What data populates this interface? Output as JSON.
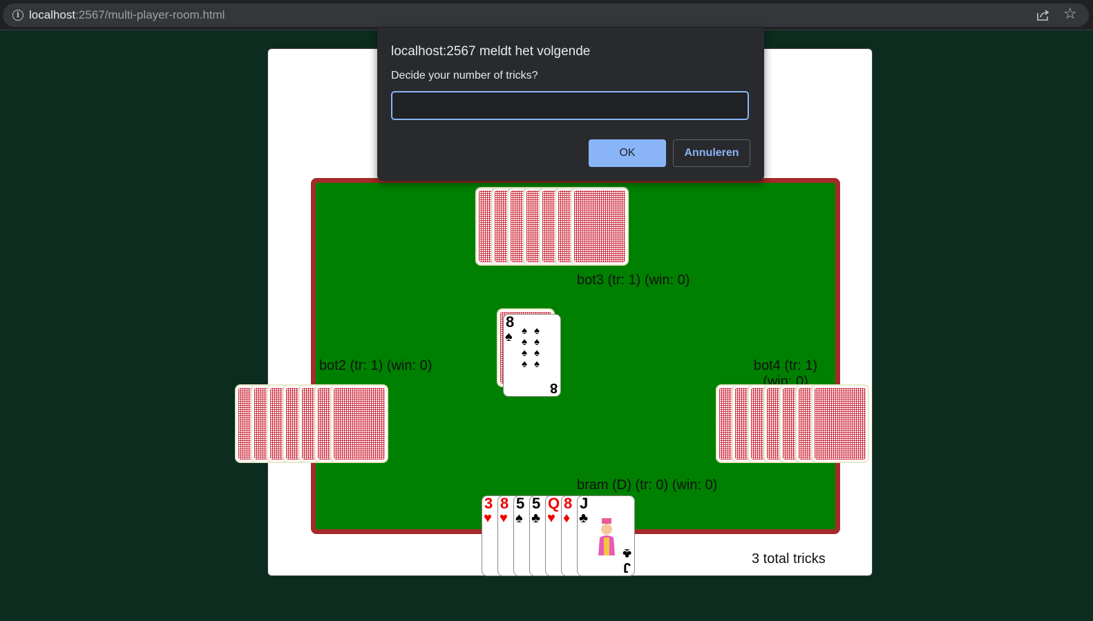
{
  "browser": {
    "url_host": "localhost",
    "url_rest": ":2567/multi-player-room.html",
    "info_icon": "info-icon",
    "share_icon": "share-icon",
    "star_icon": "star-icon"
  },
  "dialog": {
    "title": "localhost:2567 meldt het volgende",
    "message": "Decide your number of tricks?",
    "input_value": "",
    "ok_label": "OK",
    "cancel_label": "Annuleren"
  },
  "game": {
    "players": {
      "top": {
        "label": "bot3 (tr: 1) (win: 0)",
        "card_count": 7
      },
      "left": {
        "label": "bot2 (tr: 1) (win: 0)",
        "card_count": 7
      },
      "right": {
        "label": "bot4 (tr: 1) (win: 0)",
        "card_count": 7
      },
      "bottom": {
        "label": "bram (D) (tr: 0) (win: 0)"
      }
    },
    "deck_top_card": {
      "rank": "8",
      "suit": "♠",
      "color": "black"
    },
    "hand": [
      {
        "rank": "3",
        "suit": "♥",
        "color": "red"
      },
      {
        "rank": "8",
        "suit": "♥",
        "color": "red"
      },
      {
        "rank": "5",
        "suit": "♠",
        "color": "black"
      },
      {
        "rank": "5",
        "suit": "♣",
        "color": "black"
      },
      {
        "rank": "Q",
        "suit": "♥",
        "color": "red"
      },
      {
        "rank": "8",
        "suit": "♦",
        "color": "red"
      },
      {
        "rank": "J",
        "suit": "♣",
        "color": "black"
      }
    ],
    "total_tricks": "3 total tricks"
  }
}
